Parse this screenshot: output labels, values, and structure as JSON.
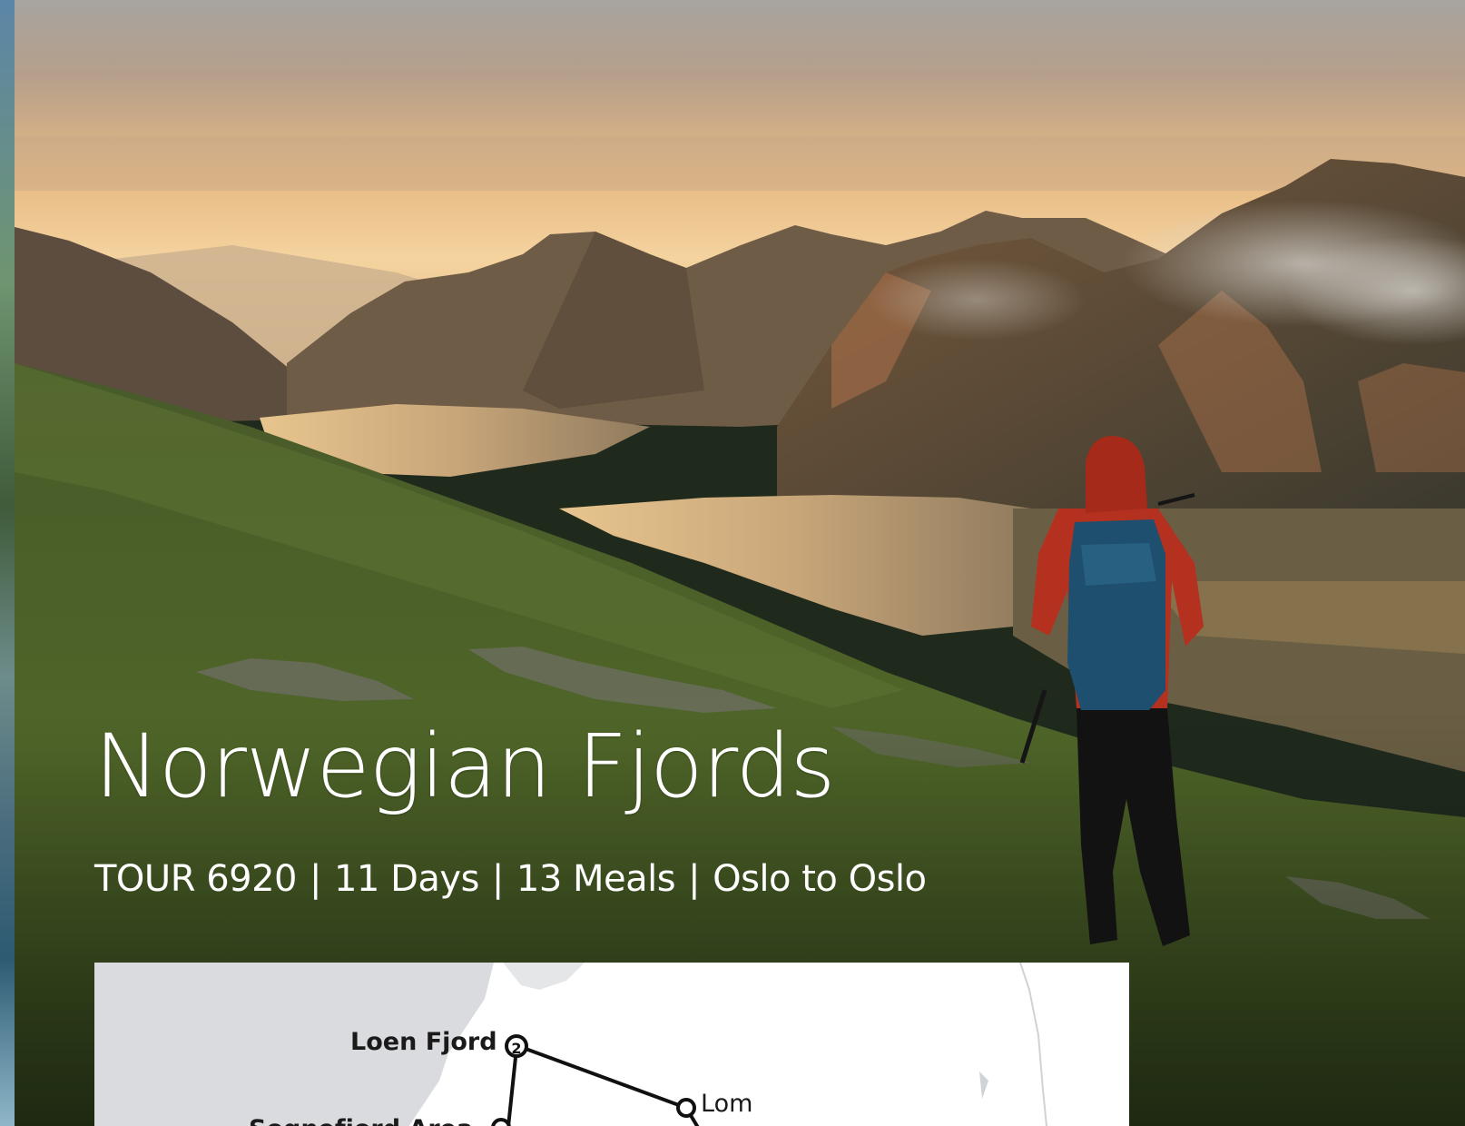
{
  "title": "Norwegian Fjords",
  "subtitle": {
    "tour": "TOUR 6920",
    "days": "11 Days",
    "meals": "13 Meals",
    "route": "Oslo to Oslo",
    "separator": "|"
  },
  "map": {
    "stops": [
      {
        "label": "Loen Fjord",
        "marker": "2"
      },
      {
        "label": "Lom",
        "marker": ""
      },
      {
        "label": "Sognefjord Area",
        "marker": ""
      }
    ]
  },
  "colors": {
    "jacket": "#b5311f",
    "backpack": "#1f4f6e",
    "sky_glow": "#f2c58e",
    "grass": "#4f6528"
  }
}
